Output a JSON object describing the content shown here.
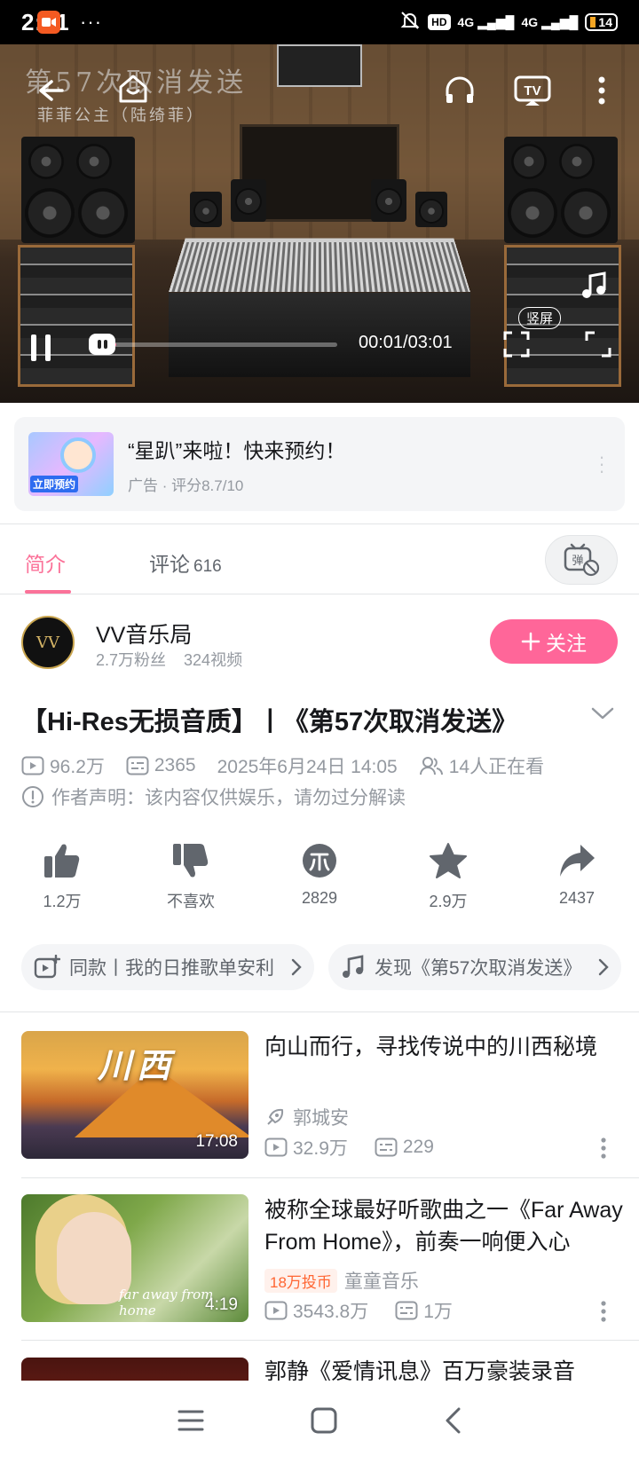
{
  "status_bar": {
    "time": "2:41",
    "dots": "···",
    "hd": "HD",
    "sig1": "4G",
    "sig2": "4G",
    "battery": "14"
  },
  "player": {
    "overlay_title": "第57次取消发送",
    "overlay_subtitle": "菲菲公主（陆绮菲）",
    "time_display": "00:01/03:01",
    "progress": 0.006,
    "vertical_label": "竖屏",
    "accent_color": "#fb7299"
  },
  "ad": {
    "title": "“星趴”来啦！快来预约！",
    "meta": "广告 · 评分8.7/10",
    "thumb_badge": "立即预约"
  },
  "tabs": {
    "intro": "简介",
    "comments": "评论",
    "comments_count": "616"
  },
  "uploader": {
    "name": "VV音乐局",
    "fans": "2.7万粉丝",
    "videos": "324视频",
    "avatar_text": "VV",
    "follow_label": "关注"
  },
  "video": {
    "title": "【Hi-Res无损音质】丨《第57次取消发送》",
    "views": "96.2万",
    "danmaku": "2365",
    "date": "2025年6月24日 14:05",
    "watching": "14人正在看",
    "declaration": "作者声明：该内容仅供娱乐，请勿过分解读"
  },
  "actions": [
    {
      "icon": "thumb-up-icon",
      "label": "1.2万"
    },
    {
      "icon": "thumb-down-icon",
      "label": "不喜欢"
    },
    {
      "icon": "coin-icon",
      "label": "2829"
    },
    {
      "icon": "star-icon",
      "label": "2.9万"
    },
    {
      "icon": "share-icon",
      "label": "2437"
    }
  ],
  "chips": {
    "left": "同款丨我的日推歌单安利",
    "right": "发现《第57次取消发送》"
  },
  "recommendations": [
    {
      "title": "向山而行，寻找传说中的川西秘境",
      "author": "郭城安",
      "views": "32.9万",
      "danmaku": "229",
      "duration": "17:08",
      "cover_text": "川西"
    },
    {
      "title": "被称全球最好听歌曲之一《Far Away From Home》，前奏一响便入心",
      "tag": "18万投币",
      "author": "童童音乐",
      "views": "3543.8万",
      "danmaku": "1万",
      "duration": "4:19",
      "cover_text": "far away from home"
    },
    {
      "title": "郭静《爱情讯息》百万豪装录音"
    }
  ]
}
